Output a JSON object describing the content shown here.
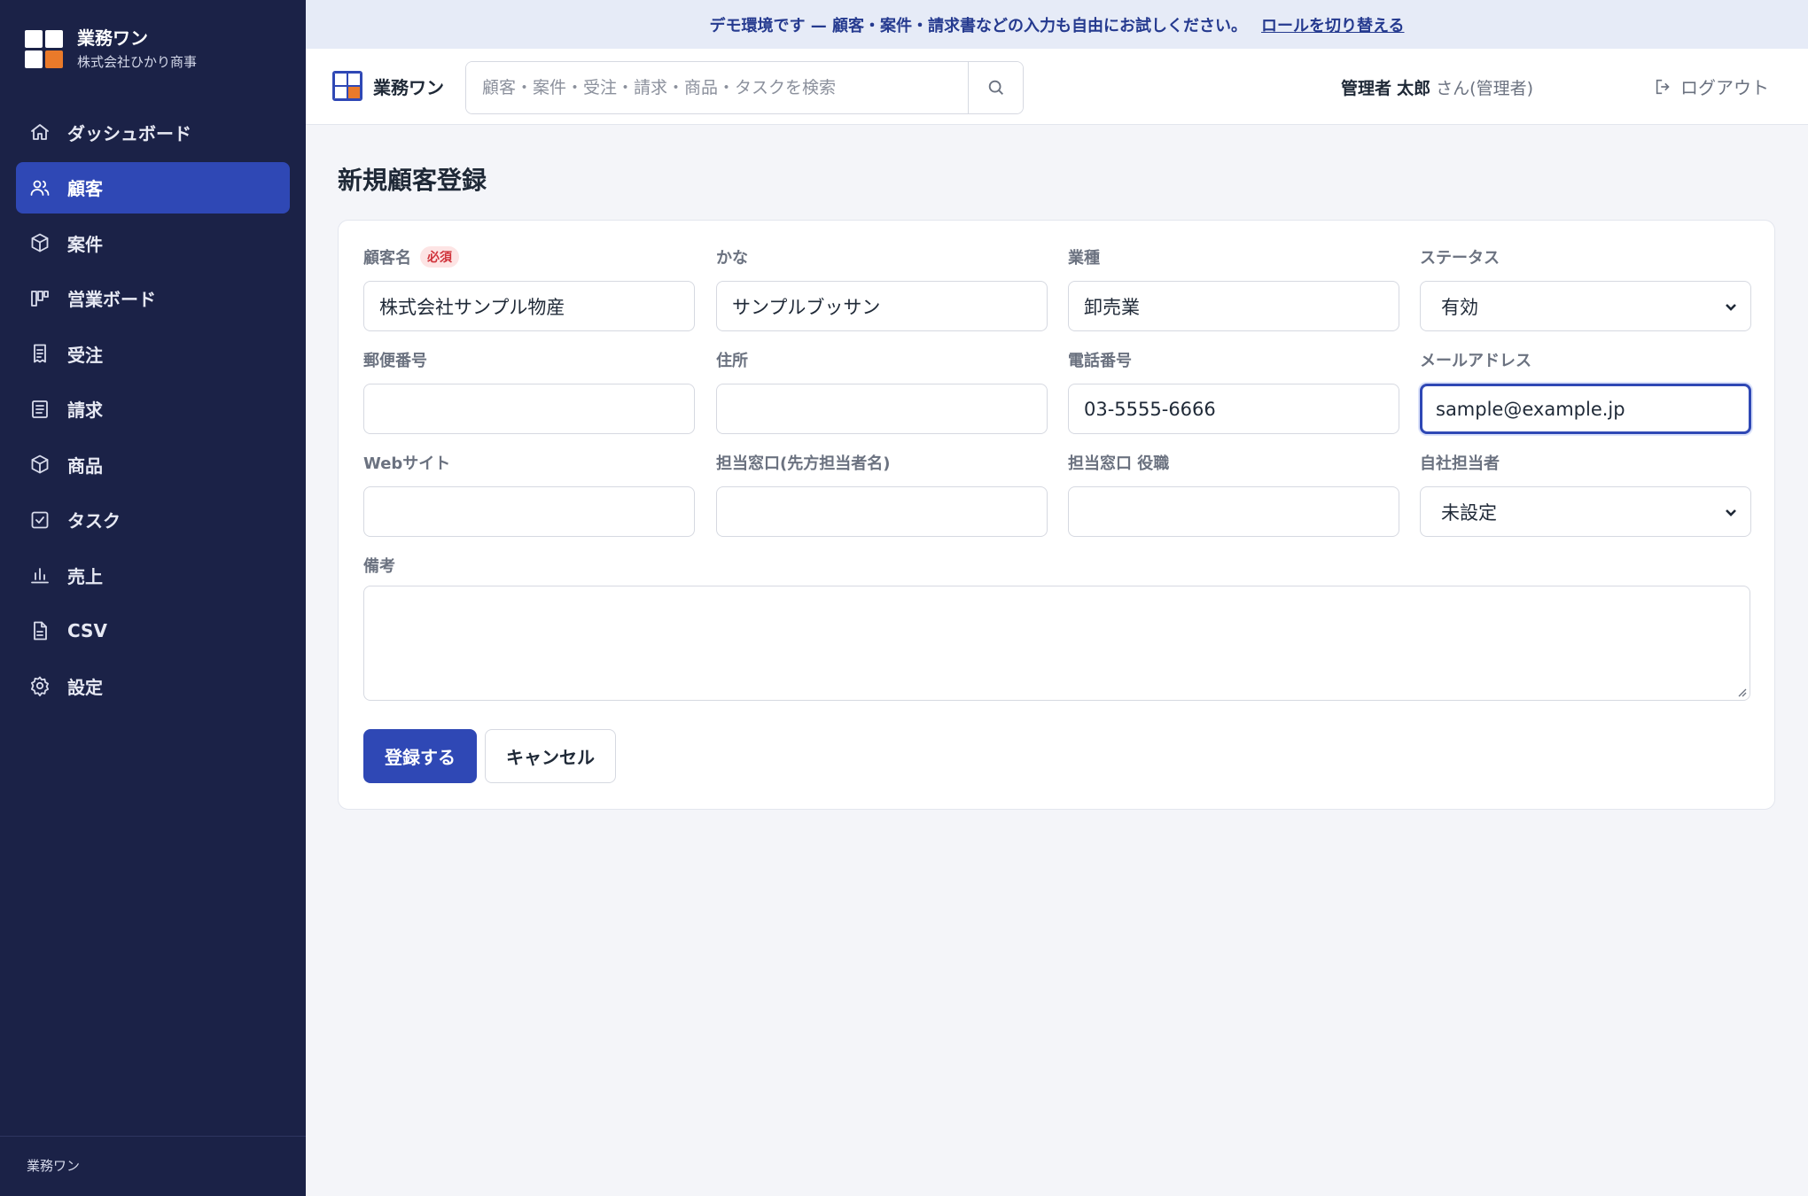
{
  "banner": {
    "text": "デモ環境です — 顧客・案件・請求書などの入力も自由にお試しください。",
    "link": "ロールを切り替える"
  },
  "sidebar": {
    "brand_name": "業務ワン",
    "company": "株式会社ひかり商事",
    "footer": "業務ワン",
    "items": [
      {
        "label": "ダッシュボード",
        "icon": "home-icon"
      },
      {
        "label": "顧客",
        "icon": "users-icon",
        "active": true
      },
      {
        "label": "案件",
        "icon": "box-icon"
      },
      {
        "label": "営業ボード",
        "icon": "kanban-icon"
      },
      {
        "label": "受注",
        "icon": "receipt-icon"
      },
      {
        "label": "請求",
        "icon": "document-icon"
      },
      {
        "label": "商品",
        "icon": "package-icon"
      },
      {
        "label": "タスク",
        "icon": "checkbox-icon"
      },
      {
        "label": "売上",
        "icon": "bar-chart-icon"
      },
      {
        "label": "CSV",
        "icon": "file-icon"
      },
      {
        "label": "設定",
        "icon": "gear-icon"
      }
    ]
  },
  "header": {
    "brand_name": "業務ワン",
    "search_placeholder": "顧客・案件・受注・請求・商品・タスクを検索",
    "user_role": "管理者",
    "user_name": "太郎",
    "user_suffix": "さん(管理者)",
    "logout": "ログアウト"
  },
  "form": {
    "title": "新規顧客登録",
    "required_badge": "必須",
    "fields": {
      "name": {
        "label": "顧客名",
        "value": "株式会社サンプル物産"
      },
      "kana": {
        "label": "かな",
        "value": "サンプルブッサン"
      },
      "industry": {
        "label": "業種",
        "value": "卸売業"
      },
      "status": {
        "label": "ステータス",
        "value": "有効"
      },
      "postal": {
        "label": "郵便番号",
        "value": ""
      },
      "address": {
        "label": "住所",
        "value": ""
      },
      "phone": {
        "label": "電話番号",
        "value": "03-5555-6666"
      },
      "email": {
        "label": "メールアドレス",
        "value": "sample@example.jp"
      },
      "website": {
        "label": "Webサイト",
        "value": ""
      },
      "contact": {
        "label": "担当窓口(先方担当者名)",
        "value": ""
      },
      "contact_title": {
        "label": "担当窓口 役職",
        "value": ""
      },
      "owner": {
        "label": "自社担当者",
        "value": "未設定"
      },
      "notes": {
        "label": "備考",
        "value": ""
      }
    },
    "submit": "登録する",
    "cancel": "キャンセル"
  },
  "colors": {
    "sidebar_bg": "#1b2247",
    "accent": "#2f48b5",
    "logo_orange": "#ea7a2a",
    "banner_bg": "#e6ebf7"
  }
}
